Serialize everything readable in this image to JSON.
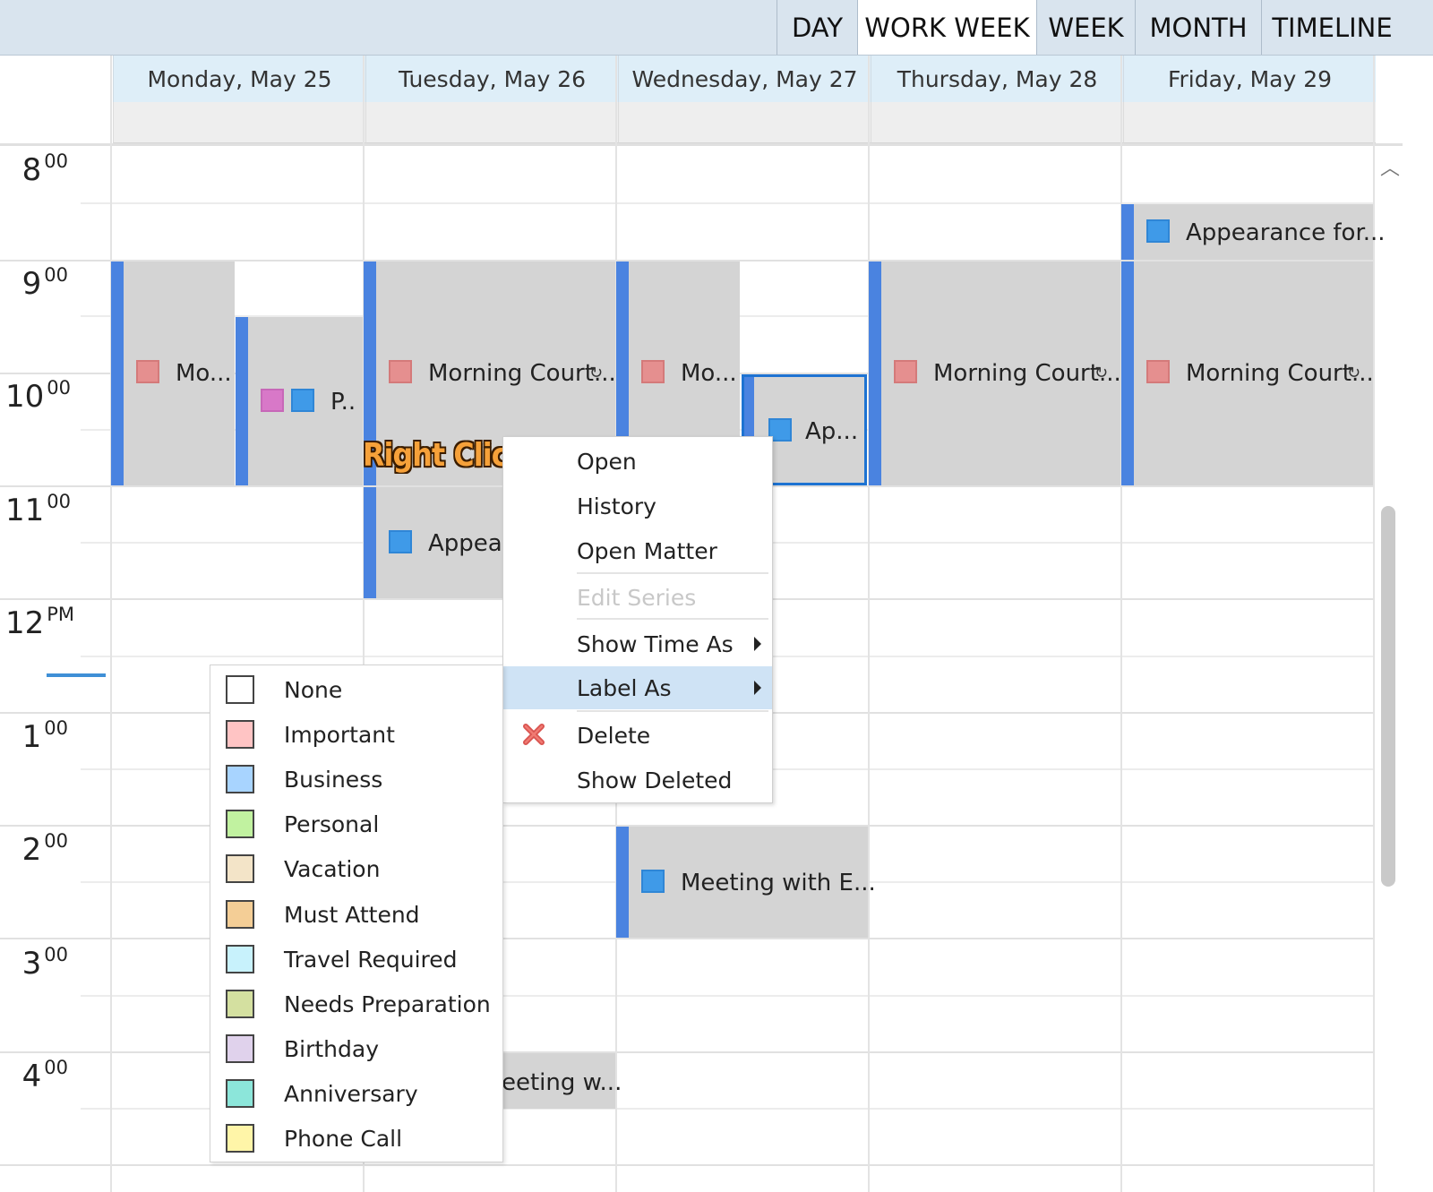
{
  "view_tabs": [
    "DAY",
    "WORK WEEK",
    "WEEK",
    "MONTH",
    "TIMELINE"
  ],
  "active_view": "WORK WEEK",
  "days": [
    "Monday, May 25",
    "Tuesday, May 26",
    "Wednesday, May 27",
    "Thursday, May 28",
    "Friday, May 29"
  ],
  "time_labels": [
    {
      "hour": "8",
      "suffix": "00"
    },
    {
      "hour": "9",
      "suffix": "00"
    },
    {
      "hour": "10",
      "suffix": "00"
    },
    {
      "hour": "11",
      "suffix": "00"
    },
    {
      "hour": "12",
      "suffix": "PM"
    },
    {
      "hour": "1",
      "suffix": "00"
    },
    {
      "hour": "2",
      "suffix": "00"
    },
    {
      "hour": "3",
      "suffix": "00"
    },
    {
      "hour": "4",
      "suffix": "00"
    }
  ],
  "appointments": {
    "mon_morning": "Mo...",
    "mon_p": "P..",
    "tue_morning": "Morning Court...",
    "tue_appear": "Appear",
    "tue_meeting": "eeting w...",
    "wed_morning": "Mo...",
    "wed_ap": "Ap...",
    "wed_meeting": "Meeting with E...",
    "thu_morning": "Morning Court...",
    "fri_appearance": "Appearance for...",
    "fri_morning": "Morning Court..."
  },
  "annotation": "Right Click",
  "context_menu": {
    "open": "Open",
    "history": "History",
    "open_matter": "Open Matter",
    "edit_series": "Edit Series",
    "show_time_as": "Show Time As",
    "label_as": "Label As",
    "delete": "Delete",
    "show_deleted": "Show Deleted"
  },
  "label_menu": [
    {
      "name": "None",
      "color": "#ffffff"
    },
    {
      "name": "Important",
      "color": "#ffc4c4"
    },
    {
      "name": "Business",
      "color": "#a8d4ff"
    },
    {
      "name": "Personal",
      "color": "#c1f2a0"
    },
    {
      "name": "Vacation",
      "color": "#f3e4c8"
    },
    {
      "name": "Must Attend",
      "color": "#f4ce96"
    },
    {
      "name": "Travel Required",
      "color": "#c8f2fc"
    },
    {
      "name": "Needs Preparation",
      "color": "#d4e0a0"
    },
    {
      "name": "Birthday",
      "color": "#e0d2ec"
    },
    {
      "name": "Anniversary",
      "color": "#8ce6da"
    },
    {
      "name": "Phone Call",
      "color": "#fff5a8"
    }
  ],
  "colors": {
    "accent_blue": "#4a83e0",
    "appointment_bg": "#d4d4d4",
    "label_important": "#e58f8f",
    "label_business": "#3f9ae8",
    "menu_highlight": "#cfe3f5"
  }
}
